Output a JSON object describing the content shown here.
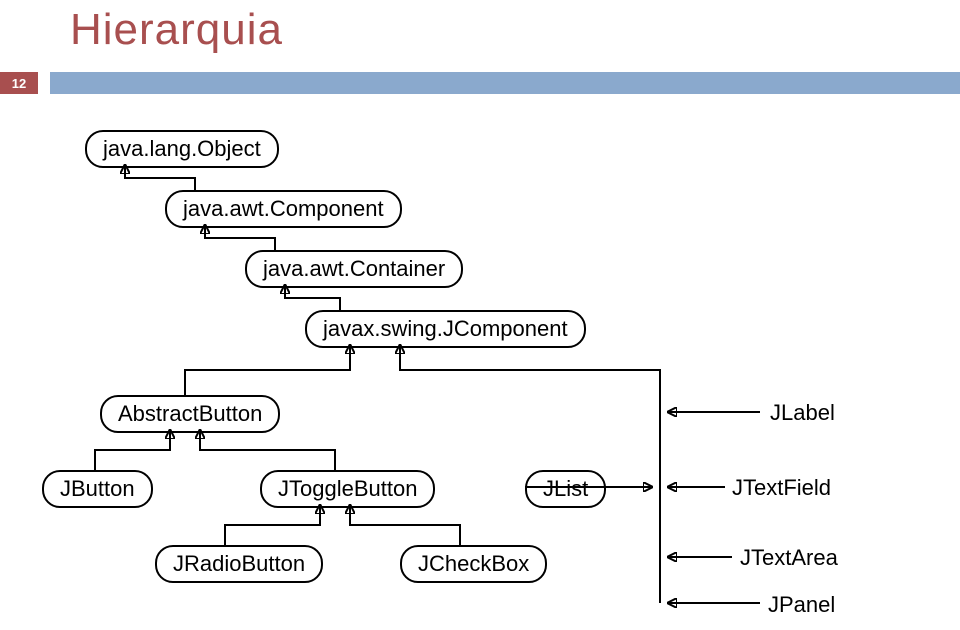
{
  "title": "Hierarquia",
  "page_number": "12",
  "nodes": {
    "object": "java.lang.Object",
    "component": "java.awt.Component",
    "container": "java.awt.Container",
    "jcomponent": "javax.swing.JComponent",
    "abstractbutton": "AbstractButton",
    "jbutton": "JButton",
    "jtogglebutton": "JToggleButton",
    "jradiobutton": "JRadioButton",
    "jcheckbox": "JCheckBox",
    "jlist": "JList",
    "jlabel": "JLabel",
    "jtextfield": "JTextField",
    "jtextarea": "JTextArea",
    "jpanel": "JPanel"
  }
}
